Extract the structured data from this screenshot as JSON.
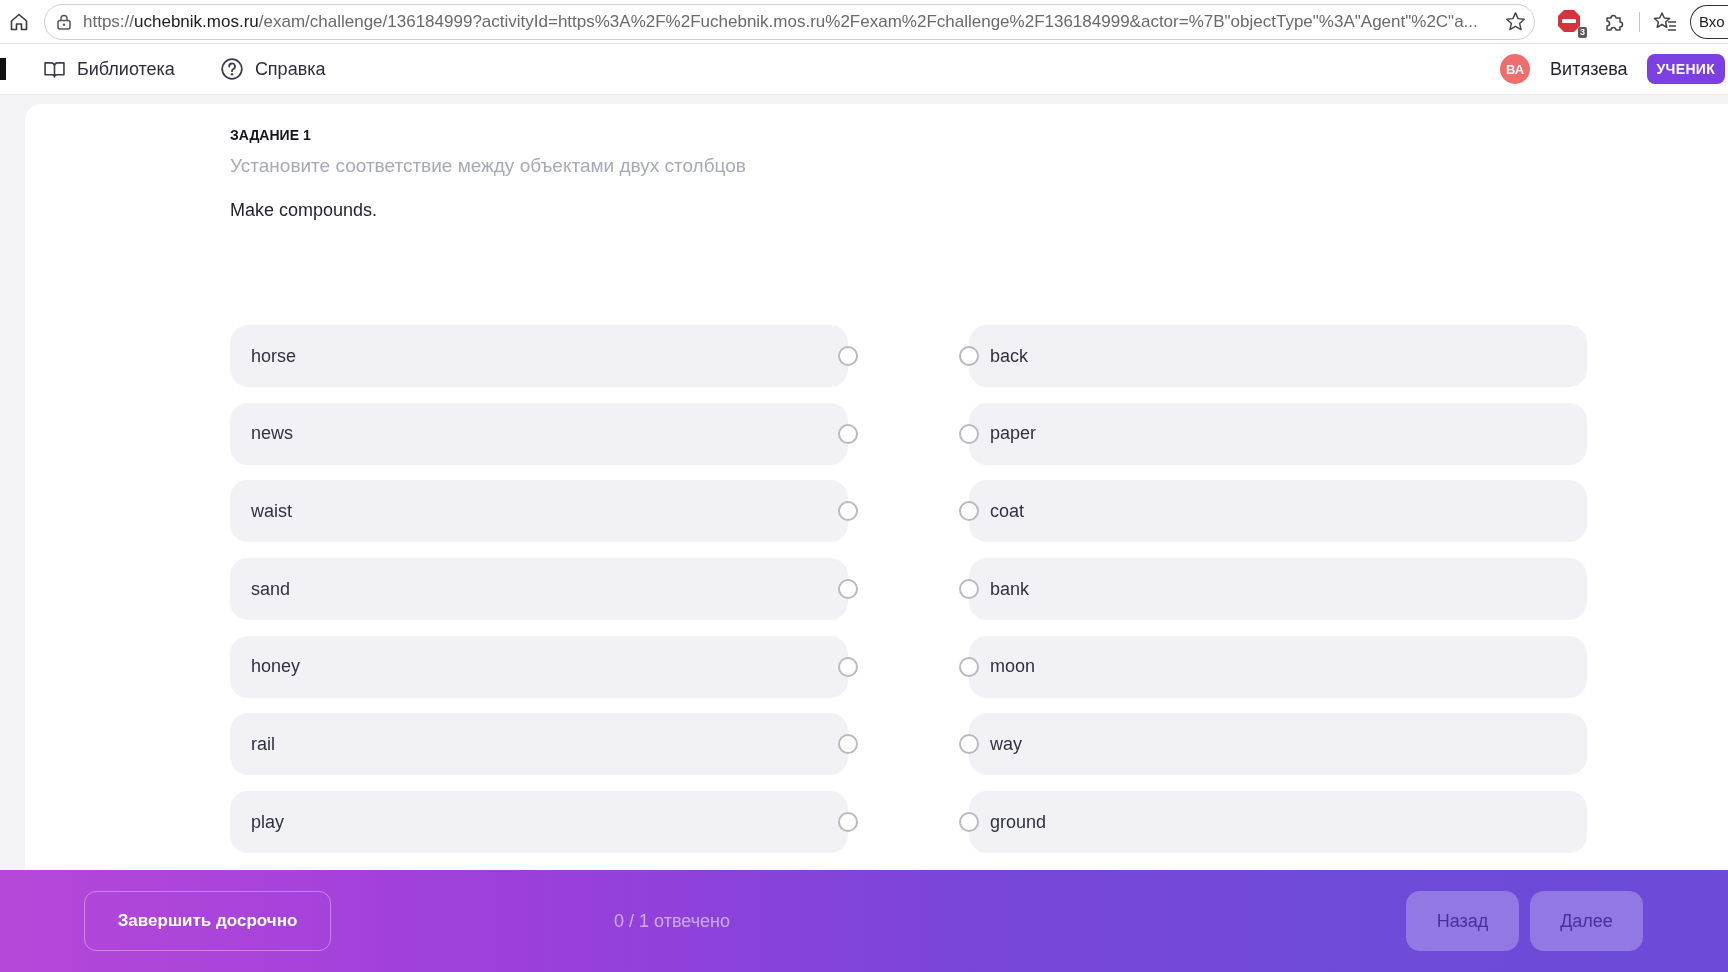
{
  "browser": {
    "url": [
      {
        "text": "https://",
        "highlighted": false
      },
      {
        "text": "uchebnik.mos.ru",
        "highlighted": true
      },
      {
        "text": "/exam/challenge/136184999?activityId=https%3A%2F%2Fuchebnik.mos.ru%2Fexam%2Fchallenge%2F136184999&actor=%7B\"objectType\"%3A\"Agent\"%2C\"a...",
        "highlighted": false
      }
    ],
    "extension_badge": "3",
    "profile_button": "Вхо"
  },
  "nav": {
    "links": [
      {
        "label": "Библиотека"
      },
      {
        "label": "Справка"
      }
    ],
    "user": {
      "initials": "ВА",
      "name": "Витязева",
      "role": "УЧЕНИК"
    }
  },
  "task": {
    "heading": "ЗАДАНИЕ 1",
    "instruction": "Установите соответствие между объектами двух столбцов",
    "prompt": "Make compounds.",
    "left_items": [
      {
        "text": "horse",
        "checked": false
      },
      {
        "text": "news",
        "checked": false
      },
      {
        "text": "waist",
        "checked": false
      },
      {
        "text": "sand",
        "checked": false
      },
      {
        "text": "honey",
        "checked": false
      },
      {
        "text": "rail",
        "checked": false
      },
      {
        "text": "play",
        "checked": false
      }
    ],
    "right_items": [
      {
        "text": "back",
        "checked": false
      },
      {
        "text": "paper",
        "checked": false
      },
      {
        "text": "coat",
        "checked": false
      },
      {
        "text": "bank",
        "checked": false
      },
      {
        "text": "moon",
        "checked": false
      },
      {
        "text": "way",
        "checked": false
      },
      {
        "text": "ground",
        "checked": false
      }
    ]
  },
  "footer": {
    "finish_button": "Завершить досрочно",
    "progress": "0 / 1 отвечено",
    "buttons": [
      {
        "label": "Назад"
      },
      {
        "label": "Далее"
      }
    ]
  }
}
